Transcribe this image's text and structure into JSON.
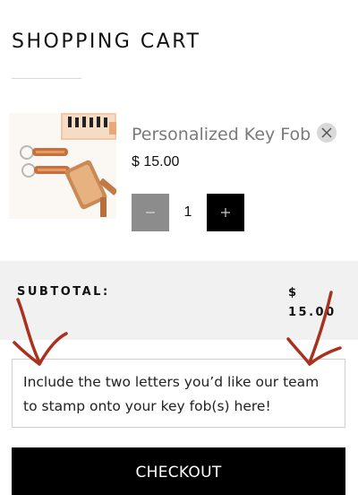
{
  "header": {
    "title": "SHOPPING CART"
  },
  "cart": {
    "item": {
      "name": "Personalized Key Fob",
      "price": "$ 15.00",
      "quantity": "1",
      "image_icon": "key-fob-product-photo-icon"
    },
    "icons": {
      "remove": "close-icon",
      "decrease": "minus-icon",
      "increase": "plus-icon"
    }
  },
  "summary": {
    "subtotal_label": "SUBTOTAL:",
    "subtotal_currency": "$",
    "subtotal_value": "15.00"
  },
  "note": {
    "text": "Include the two letters you’d like our team to stamp onto your key fob(s) here!"
  },
  "checkout": {
    "label": "CHECKOUT"
  },
  "colors": {
    "checkout_bg": "#000000",
    "minus_bg": "#8c8c8c",
    "subtotal_band": "#f1f1f1",
    "annotation_arrow": "#a8321e"
  }
}
